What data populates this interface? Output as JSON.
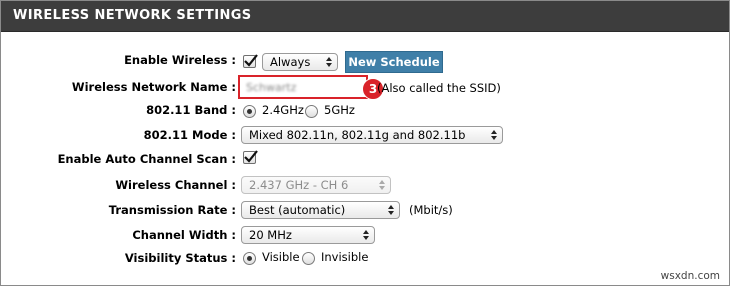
{
  "header": {
    "title": "WIRELESS NETWORK SETTINGS"
  },
  "fields": {
    "enable_wireless": {
      "label": "Enable Wireless :",
      "checked": true,
      "schedule": "Always",
      "button": "New Schedule"
    },
    "network_name": {
      "label": "Wireless Network Name :",
      "value": "Schwartz",
      "hint": "(Also called the SSID)",
      "callout": "3"
    },
    "band": {
      "label": "802.11 Band :",
      "options": [
        "2.4GHz",
        "5GHz"
      ],
      "selected": "2.4GHz"
    },
    "mode": {
      "label": "802.11 Mode :",
      "value": "Mixed 802.11n, 802.11g and 802.11b"
    },
    "auto_channel": {
      "label": "Enable Auto Channel Scan :",
      "checked": true
    },
    "channel": {
      "label": "Wireless Channel :",
      "value": "2.437 GHz - CH 6",
      "disabled": true
    },
    "rate": {
      "label": "Transmission Rate :",
      "value": "Best (automatic)",
      "unit": "(Mbit/s)"
    },
    "width": {
      "label": "Channel Width :",
      "value": "20 MHz"
    },
    "visibility": {
      "label": "Visibility Status :",
      "options": [
        "Visible",
        "Invisible"
      ],
      "selected": "Visible"
    }
  },
  "watermark": "wsxdn.com",
  "colors": {
    "header_bg": "#3d3d3d",
    "button_bg": "#3f7fa8",
    "callout_red": "#d9232a"
  }
}
